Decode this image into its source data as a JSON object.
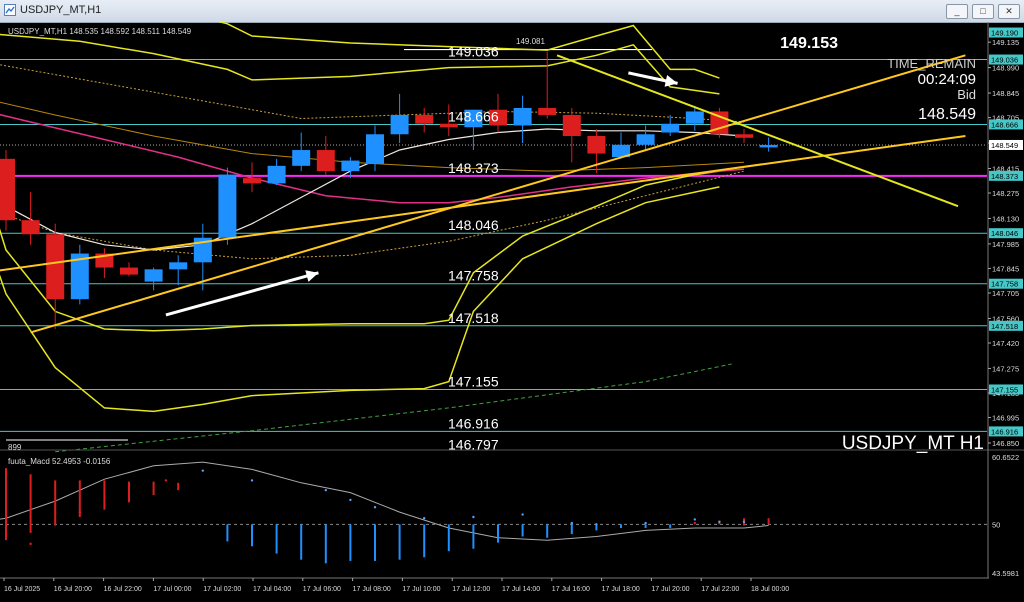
{
  "window": {
    "title": "USDJPY_MT,H1",
    "buttons": {
      "minimize": "_",
      "restore": "□",
      "close": "✕"
    }
  },
  "chart_info": {
    "header": "USDJPY_MT,H1  148.535 148.592 148.511 148.549",
    "symbol_label": "USDJPY_MT H1",
    "big_price": "149.153",
    "time_remain_label": "TIME_REMAIN",
    "time_remain": "00:24:09",
    "bid_label": "Bid",
    "bid": "148.549",
    "partial_label": "899",
    "peak_label": "149.081"
  },
  "macd": {
    "label": "fuuta_Macd 52.4953  -0.0156",
    "axis_labels": [
      "60.6522",
      "50",
      "43.5981"
    ]
  },
  "colors": {
    "bull": "#1e90ff",
    "bear": "#dc1e1e",
    "level": "#46c8c8",
    "band": "#e6e61e",
    "trend": "#ffc81e",
    "magenta": "#ff28ff"
  },
  "chart_data": {
    "type": "candlestick",
    "x_labels": [
      "16 Jul 2025",
      "16 Jul 20:00",
      "16 Jul 22:00",
      "17 Jul 00:00",
      "17 Jul 02:00",
      "17 Jul 04:00",
      "17 Jul 06:00",
      "17 Jul 08:00",
      "17 Jul 10:00",
      "17 Jul 12:00",
      "17 Jul 14:00",
      "17 Jul 16:00",
      "17 Jul 18:00",
      "17 Jul 20:00",
      "17 Jul 22:00",
      "18 Jul 00:00"
    ],
    "y_ticks": [
      "149.135",
      "148.990",
      "148.845",
      "148.705",
      "148.560",
      "148.415",
      "148.275",
      "148.130",
      "147.985",
      "147.845",
      "147.705",
      "147.560",
      "147.420",
      "147.275",
      "147.135",
      "146.995",
      "146.850"
    ],
    "ylim": [
      146.81,
      149.25
    ],
    "levels": [
      {
        "value": 149.036,
        "label": "149.036",
        "tag": "149.036"
      },
      {
        "value": 148.666,
        "label": "148.666",
        "tag": "148.666"
      },
      {
        "value": 148.373,
        "label": "148.373",
        "tag": "148.373"
      },
      {
        "value": 148.046,
        "label": "148.046",
        "tag": "148.046"
      },
      {
        "value": 147.758,
        "label": "147.758",
        "tag": "147.758"
      },
      {
        "value": 147.518,
        "label": "147.518",
        "tag": "147.518"
      },
      {
        "value": 147.155,
        "label": "147.155",
        "tag": "147.155"
      },
      {
        "value": 146.916,
        "label": "146.916",
        "tag": "146.916"
      },
      {
        "value": 146.797,
        "label": "146.797",
        "tag": ""
      }
    ],
    "top_tag": "149.190",
    "price_tag": "148.549",
    "candles": [
      {
        "o": 148.47,
        "h": 148.52,
        "l": 148.06,
        "c": 148.12
      },
      {
        "o": 148.12,
        "h": 148.28,
        "l": 147.98,
        "c": 148.04
      },
      {
        "o": 148.04,
        "h": 148.1,
        "l": 147.5,
        "c": 147.67
      },
      {
        "o": 147.67,
        "h": 147.98,
        "l": 147.64,
        "c": 147.93
      },
      {
        "o": 147.93,
        "h": 147.96,
        "l": 147.79,
        "c": 147.85
      },
      {
        "o": 147.85,
        "h": 147.88,
        "l": 147.8,
        "c": 147.81
      },
      {
        "o": 147.77,
        "h": 147.85,
        "l": 147.72,
        "c": 147.84
      },
      {
        "o": 147.84,
        "h": 147.92,
        "l": 147.75,
        "c": 147.88
      },
      {
        "o": 147.88,
        "h": 148.1,
        "l": 147.72,
        "c": 148.02
      },
      {
        "o": 148.02,
        "h": 148.42,
        "l": 147.98,
        "c": 148.38
      },
      {
        "o": 148.36,
        "h": 148.45,
        "l": 148.28,
        "c": 148.33
      },
      {
        "o": 148.33,
        "h": 148.47,
        "l": 148.32,
        "c": 148.43
      },
      {
        "o": 148.43,
        "h": 148.62,
        "l": 148.4,
        "c": 148.52
      },
      {
        "o": 148.52,
        "h": 148.6,
        "l": 148.38,
        "c": 148.4
      },
      {
        "o": 148.4,
        "h": 148.48,
        "l": 148.36,
        "c": 148.46
      },
      {
        "o": 148.44,
        "h": 148.66,
        "l": 148.4,
        "c": 148.61
      },
      {
        "o": 148.61,
        "h": 148.84,
        "l": 148.56,
        "c": 148.72
      },
      {
        "o": 148.72,
        "h": 148.76,
        "l": 148.62,
        "c": 148.67
      },
      {
        "o": 148.67,
        "h": 148.78,
        "l": 148.6,
        "c": 148.65
      },
      {
        "o": 148.65,
        "h": 148.75,
        "l": 148.52,
        "c": 148.75
      },
      {
        "o": 148.75,
        "h": 148.84,
        "l": 148.62,
        "c": 148.66
      },
      {
        "o": 148.66,
        "h": 148.83,
        "l": 148.56,
        "c": 148.76
      },
      {
        "o": 148.76,
        "h": 149.08,
        "l": 148.7,
        "c": 148.72
      },
      {
        "o": 148.72,
        "h": 148.76,
        "l": 148.45,
        "c": 148.6
      },
      {
        "o": 148.6,
        "h": 148.64,
        "l": 148.39,
        "c": 148.5
      },
      {
        "o": 148.48,
        "h": 148.62,
        "l": 148.47,
        "c": 148.55
      },
      {
        "o": 148.55,
        "h": 148.66,
        "l": 148.52,
        "c": 148.61
      },
      {
        "o": 148.62,
        "h": 148.72,
        "l": 148.6,
        "c": 148.67
      },
      {
        "o": 148.67,
        "h": 148.77,
        "l": 148.63,
        "c": 148.74
      },
      {
        "o": 148.74,
        "h": 148.76,
        "l": 148.59,
        "c": 148.61
      },
      {
        "o": 148.61,
        "h": 148.64,
        "l": 148.56,
        "c": 148.59
      },
      {
        "o": 148.535,
        "h": 148.592,
        "l": 148.511,
        "c": 148.549
      }
    ],
    "bands": {
      "outer_upper": [
        [
          -2,
          149.6
        ],
        [
          3,
          149.45
        ],
        [
          6,
          149.35
        ],
        [
          9,
          149.24
        ],
        [
          10,
          149.17
        ],
        [
          14,
          149.13
        ],
        [
          18,
          149.11
        ],
        [
          22,
          149.09
        ],
        [
          24,
          149.17
        ],
        [
          25.5,
          149.23
        ],
        [
          27,
          148.98
        ],
        [
          28,
          148.98
        ],
        [
          29,
          148.93
        ]
      ],
      "inner_upper": [
        [
          -2,
          149.2
        ],
        [
          3,
          149.14
        ],
        [
          6,
          149.07
        ],
        [
          9,
          148.98
        ],
        [
          10,
          148.92
        ],
        [
          14,
          148.94
        ],
        [
          18,
          148.99
        ],
        [
          22,
          149.0
        ],
        [
          24,
          149.06
        ],
        [
          25.5,
          149.12
        ],
        [
          27,
          148.88
        ],
        [
          28,
          148.86
        ],
        [
          29,
          148.84
        ]
      ],
      "inner_lower": [
        [
          -1,
          148.4
        ],
        [
          0,
          147.95
        ],
        [
          2,
          147.6
        ],
        [
          4,
          147.5
        ],
        [
          6,
          147.49
        ],
        [
          8,
          147.5
        ],
        [
          10,
          147.52
        ],
        [
          14,
          147.53
        ],
        [
          17,
          147.53
        ],
        [
          18,
          147.55
        ],
        [
          19,
          147.82
        ],
        [
          21,
          148.03
        ],
        [
          24,
          148.2
        ],
        [
          26,
          148.32
        ],
        [
          28,
          148.38
        ],
        [
          29,
          148.4
        ]
      ],
      "outer_lower": [
        [
          -1,
          148.1
        ],
        [
          0,
          147.7
        ],
        [
          2,
          147.28
        ],
        [
          4,
          147.05
        ],
        [
          6,
          147.03
        ],
        [
          8,
          147.07
        ],
        [
          10,
          147.12
        ],
        [
          14,
          147.15
        ],
        [
          17,
          147.16
        ],
        [
          18,
          147.2
        ],
        [
          19,
          147.6
        ],
        [
          21,
          147.9
        ],
        [
          24,
          148.1
        ],
        [
          26,
          148.22
        ],
        [
          28,
          148.28
        ],
        [
          29,
          148.31
        ]
      ]
    },
    "ma_white": [
      [
        -2,
        148.36
      ],
      [
        0,
        148.2
      ],
      [
        2,
        148.05
      ],
      [
        4,
        147.98
      ],
      [
        6,
        147.95
      ],
      [
        8,
        147.98
      ],
      [
        10,
        148.1
      ],
      [
        12,
        148.25
      ],
      [
        14,
        148.4
      ],
      [
        16,
        148.52
      ],
      [
        18,
        148.58
      ],
      [
        20,
        148.62
      ],
      [
        22,
        148.64
      ],
      [
        24,
        148.63
      ],
      [
        26,
        148.63
      ],
      [
        28,
        148.62
      ],
      [
        30,
        148.6
      ]
    ],
    "ma_magenta": [
      [
        -2,
        148.78
      ],
      [
        1,
        148.68
      ],
      [
        4,
        148.58
      ],
      [
        7,
        148.48
      ],
      [
        10,
        148.36
      ],
      [
        13,
        148.26
      ],
      [
        16,
        148.22
      ],
      [
        18,
        148.22
      ],
      [
        20,
        148.25
      ],
      [
        23,
        148.31
      ],
      [
        26,
        148.36
      ],
      [
        29,
        148.4
      ],
      [
        30,
        148.41
      ]
    ],
    "ma_orange": [
      [
        -2,
        148.85
      ],
      [
        2,
        148.72
      ],
      [
        6,
        148.6
      ],
      [
        10,
        148.5
      ],
      [
        14,
        148.45
      ],
      [
        18,
        148.42
      ],
      [
        22,
        148.4
      ],
      [
        26,
        148.42
      ],
      [
        30,
        148.45
      ]
    ],
    "ma_dotted_up": [
      [
        -2,
        149.05
      ],
      [
        4,
        148.9
      ],
      [
        8,
        148.8
      ],
      [
        12,
        148.7
      ],
      [
        16,
        148.72
      ],
      [
        20,
        148.74
      ],
      [
        24,
        148.73
      ],
      [
        28,
        148.7
      ],
      [
        30,
        148.68
      ]
    ],
    "ma_dotted_low": [
      [
        -1,
        148.2
      ],
      [
        2,
        148.05
      ],
      [
        6,
        147.95
      ],
      [
        10,
        147.9
      ],
      [
        14,
        147.92
      ],
      [
        18,
        148.0
      ],
      [
        22,
        148.12
      ],
      [
        26,
        148.26
      ],
      [
        30,
        148.4
      ]
    ],
    "ma_green_dash": [
      [
        2,
        146.8
      ],
      [
        10,
        146.92
      ],
      [
        18,
        147.05
      ],
      [
        26,
        147.2
      ],
      [
        29.5,
        147.3
      ]
    ],
    "trendlines": [
      {
        "from": [
          -3,
          147.78
        ],
        "to": [
          39,
          148.6
        ],
        "color": "#ffc81e"
      },
      {
        "from": [
          1,
          147.48
        ],
        "to": [
          39,
          149.06
        ],
        "color": "#ffc81e"
      },
      {
        "from": [
          22.4,
          149.06
        ],
        "to": [
          38.7,
          148.2
        ],
        "color": "#e6e61e"
      }
    ],
    "arrows": [
      {
        "from": [
          6.5,
          147.58
        ],
        "to": [
          12.7,
          147.82
        ]
      },
      {
        "from": [
          25.3,
          148.96
        ],
        "to": [
          27.3,
          148.9
        ]
      }
    ],
    "macd_hist": [
      [
        0,
        1,
        0.31,
        0.9
      ],
      [
        1,
        1,
        0.37,
        0.85
      ],
      [
        2,
        1,
        0.43,
        0.8
      ],
      [
        3,
        1,
        0.5,
        0.8
      ],
      [
        4,
        1,
        0.56,
        0.8
      ],
      [
        5,
        1,
        0.62,
        0.79
      ],
      [
        6,
        1,
        0.68,
        0.79
      ],
      [
        7,
        1,
        0.72,
        0.78
      ],
      [
        8,
        1,
        0.73,
        0.73
      ],
      [
        9,
        0,
        0.3,
        0.44
      ],
      [
        10,
        0,
        0.26,
        0.44
      ],
      [
        11,
        0,
        0.2,
        0.44
      ],
      [
        12,
        0,
        0.15,
        0.44
      ],
      [
        13,
        0,
        0.12,
        0.44
      ],
      [
        14,
        0,
        0.14,
        0.44
      ],
      [
        15,
        0,
        0.14,
        0.44
      ],
      [
        16,
        0,
        0.15,
        0.44
      ],
      [
        17,
        0,
        0.17,
        0.44
      ],
      [
        18,
        0,
        0.22,
        0.44
      ],
      [
        19,
        0,
        0.24,
        0.44
      ],
      [
        20,
        0,
        0.29,
        0.44
      ],
      [
        21,
        0,
        0.34,
        0.44
      ],
      [
        22,
        0,
        0.33,
        0.44
      ],
      [
        23,
        0,
        0.36,
        0.44
      ],
      [
        24,
        0,
        0.39,
        0.44
      ],
      [
        25,
        0,
        0.41,
        0.44
      ],
      [
        26,
        0,
        0.41,
        0.44
      ],
      [
        27,
        0,
        0.41,
        0.44
      ],
      [
        28,
        1,
        0.44,
        0.46
      ],
      [
        29,
        1,
        0.44,
        0.47
      ],
      [
        30,
        1,
        0.43,
        0.49
      ],
      [
        31,
        1,
        0.44,
        0.49
      ]
    ],
    "macd_signal": [
      [
        -2,
        0.43
      ],
      [
        0,
        0.49
      ],
      [
        2,
        0.63
      ],
      [
        4,
        0.81
      ],
      [
        6,
        0.92
      ],
      [
        8,
        0.95
      ],
      [
        10,
        0.89
      ],
      [
        12,
        0.78
      ],
      [
        14,
        0.7
      ],
      [
        16,
        0.54
      ],
      [
        18,
        0.41
      ],
      [
        20,
        0.33
      ],
      [
        22,
        0.31
      ],
      [
        24,
        0.34
      ],
      [
        26,
        0.39
      ],
      [
        28,
        0.41
      ],
      [
        30,
        0.41
      ],
      [
        31,
        0.43
      ]
    ],
    "macd_dots": [
      [
        -1,
        0.16
      ],
      [
        1,
        0.28
      ],
      [
        3,
        0.54
      ],
      [
        5,
        0.64
      ],
      [
        6.5,
        0.8
      ],
      [
        8,
        0.88
      ],
      [
        10,
        0.8
      ],
      [
        13,
        0.72
      ],
      [
        14,
        0.64
      ],
      [
        15,
        0.58
      ],
      [
        17,
        0.49
      ],
      [
        19,
        0.5
      ],
      [
        21,
        0.52
      ],
      [
        23,
        0.45
      ],
      [
        24,
        0.44
      ],
      [
        26,
        0.45
      ],
      [
        28,
        0.48
      ],
      [
        29,
        0.46
      ],
      [
        30,
        0.46
      ]
    ],
    "macd_ylim": [
      0,
      1
    ]
  }
}
